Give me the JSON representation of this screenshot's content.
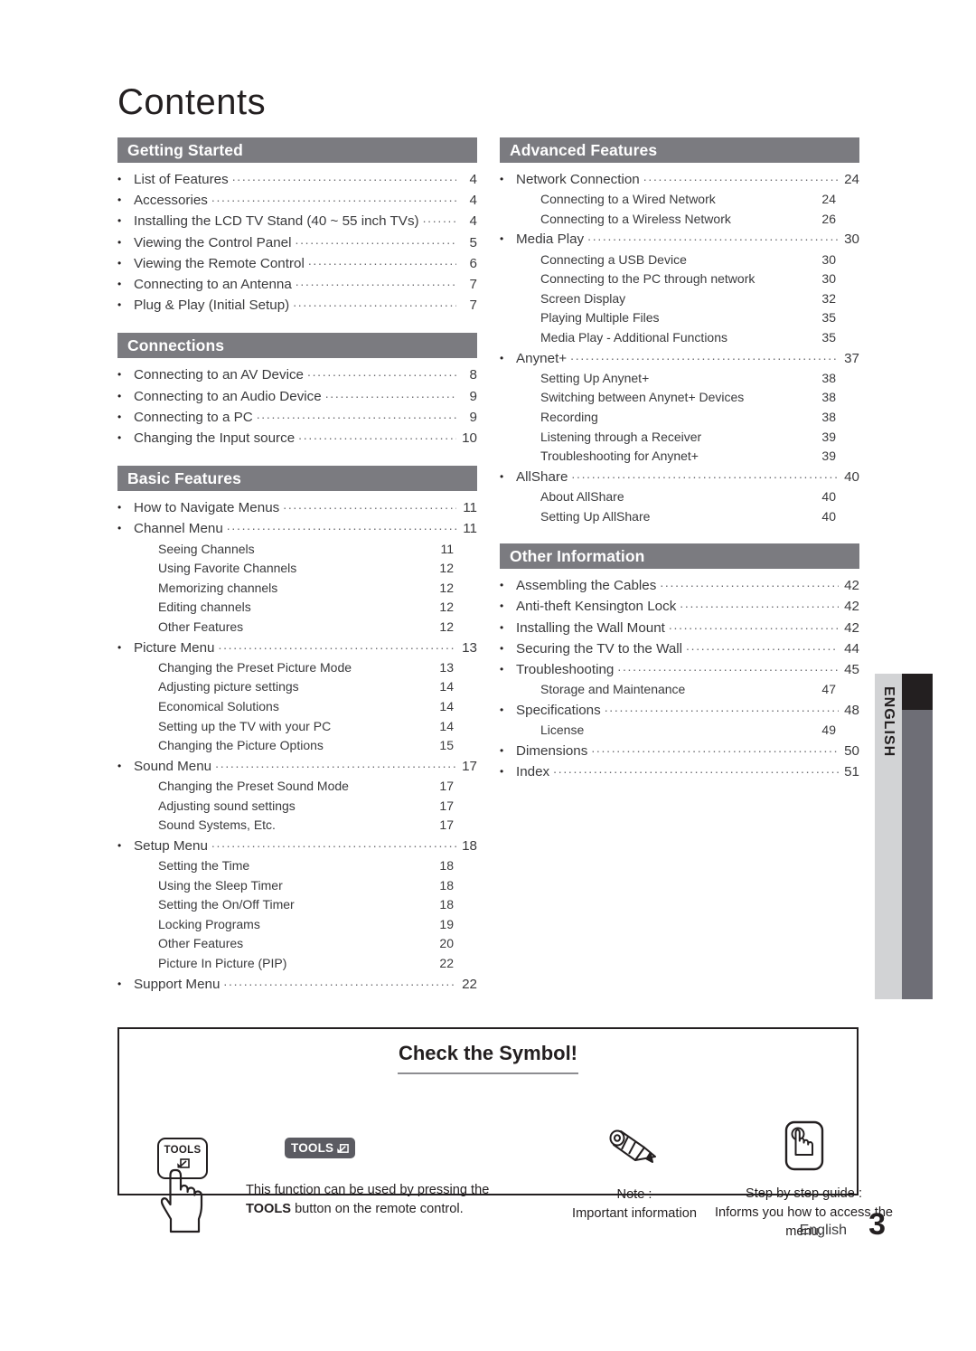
{
  "title": "Contents",
  "footer": {
    "language": "English",
    "page_number": "3"
  },
  "side_tab": {
    "label": "ENGLISH"
  },
  "columns": {
    "left": [
      {
        "heading": "Getting Started",
        "entries": [
          {
            "type": "main",
            "label": "List of Features",
            "page": "4"
          },
          {
            "type": "main",
            "label": "Accessories",
            "page": "4"
          },
          {
            "type": "main",
            "label": "Installing the LCD TV Stand (40 ~ 55 inch TVs)",
            "page": "4"
          },
          {
            "type": "main",
            "label": "Viewing the Control Panel",
            "page": "5"
          },
          {
            "type": "main",
            "label": "Viewing the Remote Control",
            "page": "6"
          },
          {
            "type": "main",
            "label": "Connecting to an Antenna",
            "page": "7"
          },
          {
            "type": "main",
            "label": "Plug & Play (Initial Setup)",
            "page": "7"
          }
        ]
      },
      {
        "heading": "Connections",
        "entries": [
          {
            "type": "main",
            "label": "Connecting to an AV Device",
            "page": "8"
          },
          {
            "type": "main",
            "label": "Connecting to an Audio Device",
            "page": "9"
          },
          {
            "type": "main",
            "label": "Connecting to a PC",
            "page": "9"
          },
          {
            "type": "main",
            "label": "Changing the Input source",
            "page": "10"
          }
        ]
      },
      {
        "heading": "Basic Features",
        "entries": [
          {
            "type": "main",
            "label": "How to Navigate Menus",
            "page": "11"
          },
          {
            "type": "main",
            "label": "Channel Menu",
            "page": "11"
          },
          {
            "type": "sub",
            "label": "Seeing Channels",
            "page": "11"
          },
          {
            "type": "sub",
            "label": "Using Favorite Channels",
            "page": "12"
          },
          {
            "type": "sub",
            "label": "Memorizing channels",
            "page": "12"
          },
          {
            "type": "sub",
            "label": "Editing channels",
            "page": "12"
          },
          {
            "type": "sub",
            "label": "Other Features",
            "page": "12"
          },
          {
            "type": "main",
            "label": "Picture Menu",
            "page": "13"
          },
          {
            "type": "sub",
            "label": "Changing the Preset Picture Mode",
            "page": "13"
          },
          {
            "type": "sub",
            "label": "Adjusting picture settings",
            "page": "14"
          },
          {
            "type": "sub",
            "label": "Economical Solutions",
            "page": "14"
          },
          {
            "type": "sub",
            "label": "Setting up the TV with your PC",
            "page": "14"
          },
          {
            "type": "sub",
            "label": "Changing the Picture Options",
            "page": "15"
          },
          {
            "type": "main",
            "label": "Sound Menu",
            "page": "17"
          },
          {
            "type": "sub",
            "label": "Changing the Preset Sound Mode",
            "page": "17"
          },
          {
            "type": "sub",
            "label": "Adjusting sound settings",
            "page": "17"
          },
          {
            "type": "sub",
            "label": "Sound Systems, Etc.",
            "page": "17"
          },
          {
            "type": "main",
            "label": "Setup Menu",
            "page": "18"
          },
          {
            "type": "sub",
            "label": "Setting the Time",
            "page": "18"
          },
          {
            "type": "sub",
            "label": "Using the Sleep Timer",
            "page": "18"
          },
          {
            "type": "sub",
            "label": "Setting the On/Off Timer",
            "page": "18"
          },
          {
            "type": "sub",
            "label": "Locking Programs",
            "page": "19"
          },
          {
            "type": "sub",
            "label": "Other Features",
            "page": "20"
          },
          {
            "type": "sub",
            "label": "Picture In Picture (PIP)",
            "page": "22"
          },
          {
            "type": "main",
            "label": "Support Menu",
            "page": "22"
          }
        ]
      }
    ],
    "right": [
      {
        "heading": "Advanced Features",
        "entries": [
          {
            "type": "main",
            "label": "Network Connection",
            "page": "24"
          },
          {
            "type": "sub",
            "label": "Connecting to a Wired Network",
            "page": "24"
          },
          {
            "type": "sub",
            "label": "Connecting to a Wireless Network",
            "page": "26"
          },
          {
            "type": "main",
            "label": "Media Play",
            "page": "30"
          },
          {
            "type": "sub",
            "label": "Connecting a USB Device",
            "page": "30"
          },
          {
            "type": "sub",
            "label": "Connecting to the PC through network",
            "page": "30"
          },
          {
            "type": "sub",
            "label": "Screen Display",
            "page": "32"
          },
          {
            "type": "sub",
            "label": "Playing Multiple Files",
            "page": "35"
          },
          {
            "type": "sub",
            "label": "Media Play - Additional Functions",
            "page": "35"
          },
          {
            "type": "main",
            "label": "Anynet+",
            "page": "37"
          },
          {
            "type": "sub",
            "label": "Setting Up Anynet+",
            "page": "38"
          },
          {
            "type": "sub",
            "label": "Switching between Anynet+ Devices",
            "page": "38"
          },
          {
            "type": "sub",
            "label": "Recording",
            "page": "38"
          },
          {
            "type": "sub",
            "label": "Listening through a Receiver",
            "page": "39"
          },
          {
            "type": "sub",
            "label": "Troubleshooting for Anynet+",
            "page": "39"
          },
          {
            "type": "main",
            "label": "AllShare",
            "page": "40"
          },
          {
            "type": "sub",
            "label": "About AllShare",
            "page": "40"
          },
          {
            "type": "sub",
            "label": "Setting Up AllShare",
            "page": "40"
          }
        ]
      },
      {
        "heading": "Other Information",
        "entries": [
          {
            "type": "main",
            "label": "Assembling the Cables",
            "page": "42"
          },
          {
            "type": "main",
            "label": "Anti-theft Kensington Lock",
            "page": "42"
          },
          {
            "type": "main",
            "label": "Installing the Wall Mount",
            "page": "42"
          },
          {
            "type": "main",
            "label": "Securing the TV to the Wall",
            "page": "44"
          },
          {
            "type": "main",
            "label": "Troubleshooting",
            "page": "45"
          },
          {
            "type": "sub",
            "label": "Storage and Maintenance",
            "page": "47"
          },
          {
            "type": "main",
            "label": "Specifications",
            "page": "48"
          },
          {
            "type": "sub",
            "label": "License",
            "page": "49"
          },
          {
            "type": "main",
            "label": "Dimensions",
            "page": "50"
          },
          {
            "type": "main",
            "label": "Index",
            "page": "51"
          }
        ]
      }
    ]
  },
  "symbol_box": {
    "title": "Check the Symbol!",
    "remote_key_label": "TOOLS",
    "tools_badge_label": "TOOLS",
    "tools_description_pre": "This function can be used by pressing the ",
    "tools_description_bold": "TOOLS",
    "tools_description_post": " button on the remote control.",
    "note_title": "Note :",
    "note_body": "Important information",
    "guide_title": "Step by step guide :",
    "guide_body": "Informs you how to access the menu."
  },
  "colors": {
    "section_bar": "#7b7b80",
    "tab_light": "#d2d3d5",
    "tab_dark": "#6e6e76",
    "tab_cap": "#231f20",
    "badge": "#5b5b62",
    "text": "#231f20"
  }
}
